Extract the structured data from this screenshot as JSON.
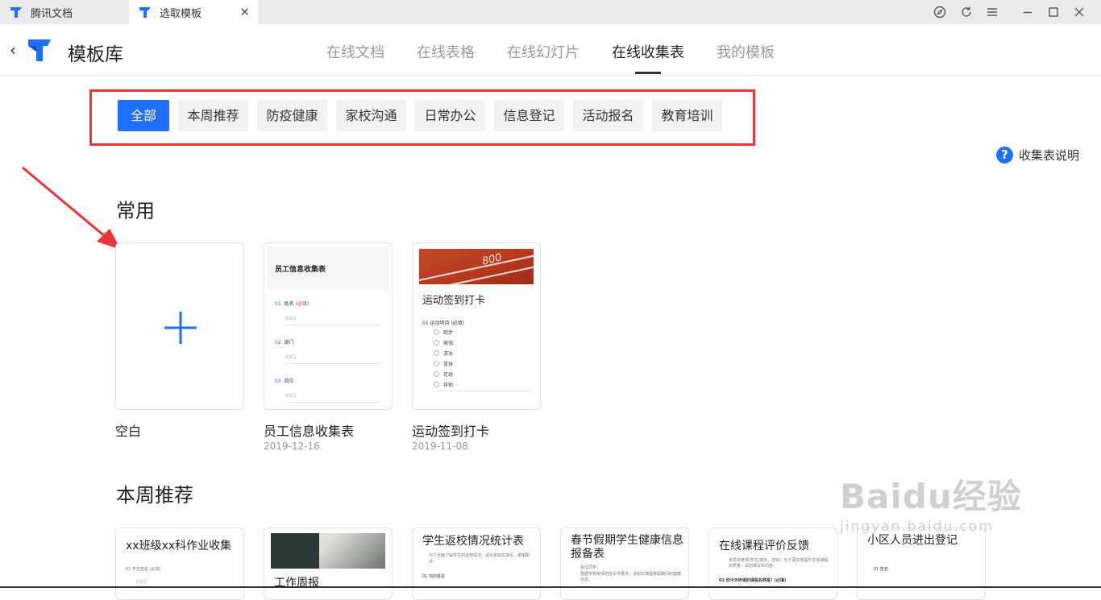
{
  "tabs": [
    {
      "label": "腾讯文档",
      "icon": "tencent-docs-logo-icon"
    },
    {
      "label": "选取模板",
      "icon": "tencent-docs-logo-icon"
    }
  ],
  "window_controls": [
    "compass-icon",
    "refresh-icon",
    "menu-icon",
    "minimize-icon",
    "maximize-icon",
    "close-icon"
  ],
  "header": {
    "title": "模板库",
    "nav": [
      "在线文档",
      "在线表格",
      "在线幻灯片",
      "在线收集表",
      "我的模板"
    ],
    "active_nav": "在线收集表"
  },
  "categories": [
    "全部",
    "本周推荐",
    "防疫健康",
    "家校沟通",
    "日常办公",
    "信息登记",
    "活动报名",
    "教育培训"
  ],
  "active_category": "全部",
  "help_label": "收集表说明",
  "sections": {
    "common": "常用",
    "weekly": "本周推荐"
  },
  "common_cards": [
    {
      "name": "空白",
      "date": ""
    },
    {
      "name": "员工信息收集表",
      "date": "2019-12-16",
      "preview": {
        "title": "员工信息收集表",
        "questions": [
          {
            "num": "01",
            "label": "姓名",
            "required": "(必填)",
            "placeholder": "请填写"
          },
          {
            "num": "02",
            "label": "部门",
            "required": "",
            "placeholder": "请填写"
          },
          {
            "num": "03",
            "label": "岗位",
            "required": "",
            "placeholder": "请填写"
          }
        ]
      }
    },
    {
      "name": "运动签到打卡",
      "date": "2019-11-08",
      "preview": {
        "title": "运动签到打卡",
        "track_label": "800",
        "question": "01 运动项目 (必填)",
        "options": [
          "跑步",
          "瑜伽",
          "游泳",
          "篮球",
          "足球",
          "其他"
        ]
      }
    }
  ],
  "weekly_cards": [
    {
      "title": "xx班级xx科作业收集",
      "text": "01 学生姓名 (必填)",
      "sub": "请填写"
    },
    {
      "title": "工作周报",
      "text": "",
      "sub": ""
    },
    {
      "title": "学生返校情况统计表",
      "text": "为了全面了解学生的返校情况，请大家如实填写，谢谢配合。",
      "sub": "01 你的姓名"
    },
    {
      "title": "春节假期学生健康信息报备表",
      "text": "各位同学：",
      "sub": "根据学校疫情防控工作要求，请如实填报寒假期间的健康信息。"
    },
    {
      "title": "在线课程评价反馈",
      "text": "亲爱的老师/学生/家长，您好！为了更好地提升在线课程的质量，请您填写本问卷。",
      "sub": "01 你今天听课的课程名称是？(必填)"
    },
    {
      "title": "小区人员进出登记",
      "text": "01 姓名",
      "sub": ""
    }
  ],
  "watermark": {
    "line1": "Baidu经验",
    "line2": "jingyan.baidu.com"
  },
  "colors": {
    "accent": "#1e6fff",
    "highlight_box": "#e8353a"
  }
}
